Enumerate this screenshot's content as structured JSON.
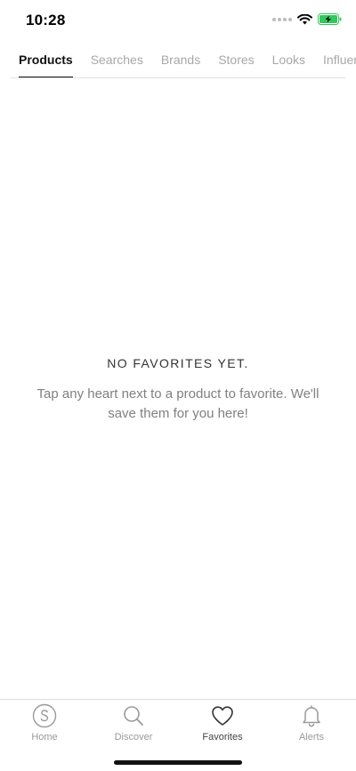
{
  "status_bar": {
    "time": "10:28"
  },
  "tabs": [
    {
      "label": "Products",
      "active": true
    },
    {
      "label": "Searches",
      "active": false
    },
    {
      "label": "Brands",
      "active": false
    },
    {
      "label": "Stores",
      "active": false
    },
    {
      "label": "Looks",
      "active": false
    },
    {
      "label": "Influence",
      "active": false
    }
  ],
  "empty_state": {
    "title": "NO FAVORITES YET.",
    "message": "Tap any heart next to a product to favorite. We'll save them for you here!"
  },
  "bottom_nav": [
    {
      "label": "Home",
      "icon": "shopstyle-logo-icon",
      "active": false
    },
    {
      "label": "Discover",
      "icon": "search-icon",
      "active": false
    },
    {
      "label": "Favorites",
      "icon": "heart-icon",
      "active": true
    },
    {
      "label": "Alerts",
      "icon": "bell-icon",
      "active": false
    }
  ],
  "colors": {
    "active": "#111111",
    "inactive": "#a8a8a8",
    "battery": "#34c759"
  }
}
